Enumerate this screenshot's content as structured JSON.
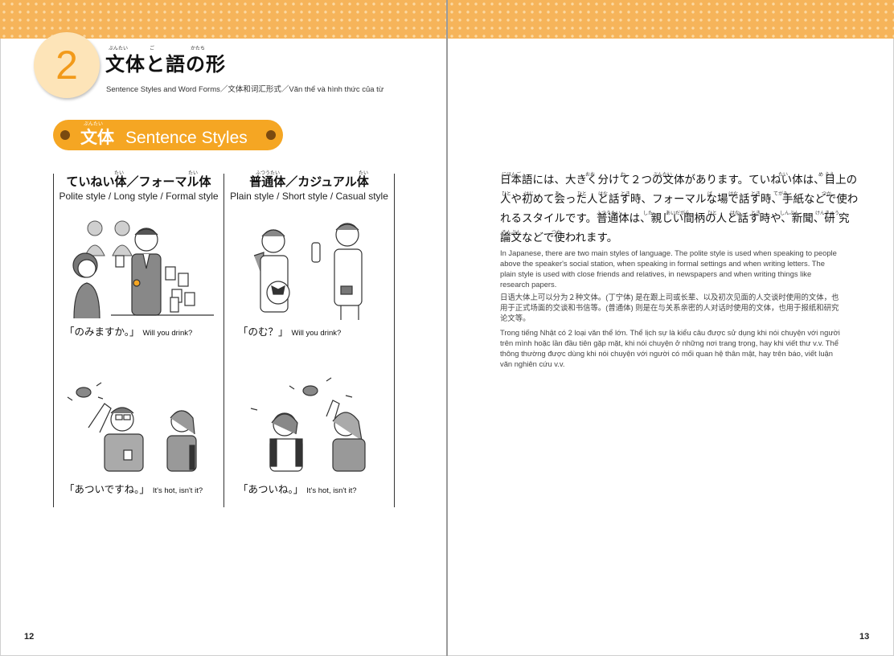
{
  "chapter": {
    "number": "2",
    "title": "文体と語の形",
    "title_ruby": [
      "ぶんたい",
      "ご",
      "かたち"
    ],
    "subtitle": "Sentence Styles and Word Forms／文体和词汇形式／Văn thể và hình thức của từ"
  },
  "section": {
    "kanji": "文体",
    "kanji_ruby": "ぶんたい",
    "label": "Sentence Styles"
  },
  "columns": [
    {
      "head": "ていねい体／フォーマル体",
      "head_ruby": "たい",
      "sub": "Polite style / Long style / Formal style",
      "captions": [
        {
          "jp": "「のみますか。」",
          "en": "Will you drink?"
        },
        {
          "jp": "「あついですね。」",
          "en": "It's hot, isn't it?"
        }
      ]
    },
    {
      "head": "普通体／カジュアル体",
      "head_ruby": "ふつうたい",
      "sub": "Plain style / Short style / Casual style",
      "captions": [
        {
          "jp": "「のむ？」",
          "en": "Will you drink?"
        },
        {
          "jp": "「あついね。」",
          "en": "It's hot, isn't it?"
        }
      ]
    }
  ],
  "right": {
    "jp_lines": [
      "日本語には、大きく分けて２つの文体があります。ていねい体は、目上の",
      "人や初めて会った人と話す時、フォーマルな場で話す時、手紙などで使わ",
      "れるスタイルです。普通体は、親しい間柄の人と話す時や、新聞、研 究",
      "論文などで使われます。"
    ],
    "jp_ruby": [
      [
        "にほんご",
        "おお",
        "わ",
        "ぶんたい",
        "たい",
        "め うえ"
      ],
      [
        "ひと",
        "はじ",
        "あ",
        "ひと",
        "はな",
        "とき",
        "ば",
        "はな",
        "とき",
        "てがみ",
        "つか"
      ],
      [
        "ふつうたい",
        "した",
        "あいだがら",
        "ひと",
        "はな",
        "とき",
        "しんぶん",
        "けんきゅう"
      ],
      [
        "ろんぶん",
        "つか"
      ]
    ],
    "en": "In Japanese, there are two main styles of language. The polite style is used when speaking to people above the speaker's social station, when speaking in formal settings and when writing letters. The plain style is used with close friends and relatives, in newspapers and when writing things like research papers.",
    "zh": "日语大体上可以分为２种文体。(丁宁体) 是在跟上司或长辈、以及初次见面的人交谈时使用的文体，也用于正式场面的交谈和书信等。(普通体) 则是在与关系亲密的人对话时使用的文体，也用于报纸和研究论文等。",
    "vi": "Trong tiếng Nhật có 2 loại văn thể lớn. Thể lịch sự là kiểu câu được sử dụng khi nói chuyện với người trên mình hoặc lần đầu tiên gặp mặt, khi nói chuyện ở những nơi trang trọng, hay khi viết thư v.v. Thể thông thường được dùng khi nói chuyện với người có mối quan hệ thân mật, hay trên báo, viết luận văn nghiên cứu v.v."
  },
  "page_numbers": {
    "left": "12",
    "right": "13"
  },
  "colors": {
    "accent": "#f5a623",
    "dots": "#f6b45a",
    "circle": "#fde4b8",
    "number": "#f29a1a"
  }
}
